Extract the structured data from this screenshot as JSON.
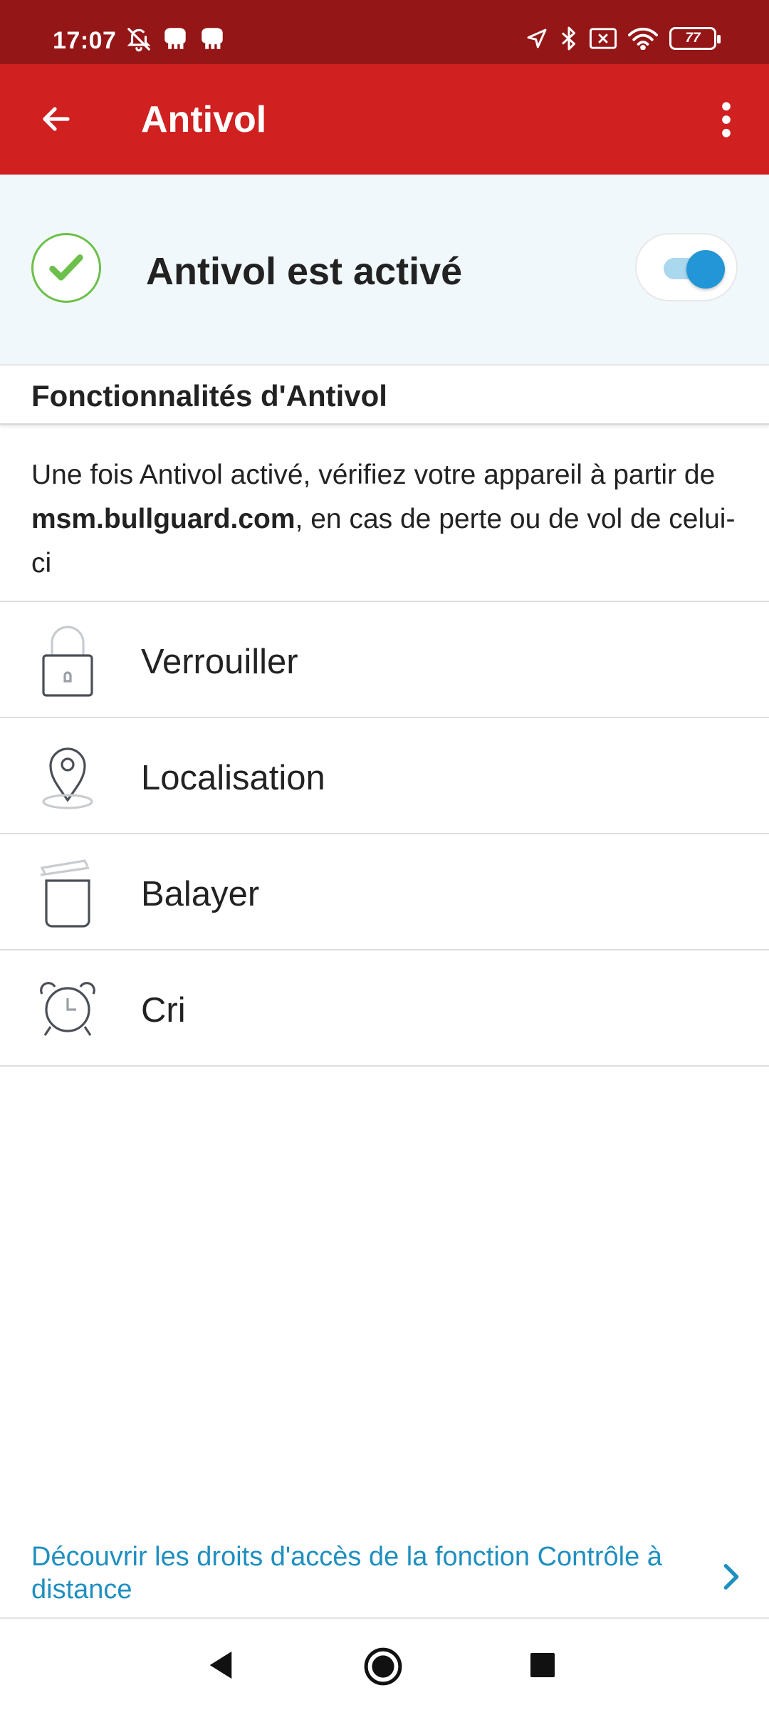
{
  "status_bar": {
    "time": "17:07",
    "battery": "77",
    "left_icons": [
      "muted-alarm-icon",
      "bulldog-icon",
      "bulldog-icon"
    ],
    "right_icons": [
      "location-arrow-icon",
      "bluetooth-icon",
      "no-sim-icon",
      "wifi-icon",
      "battery-icon"
    ]
  },
  "app_bar": {
    "title": "Antivol",
    "colors": {
      "status_bar": "#951617",
      "app_bar": "#d02020"
    }
  },
  "status": {
    "text": "Antivol est activé",
    "toggle_on": true,
    "accent": "#2296d6",
    "check_color": "#6cc04a"
  },
  "section": {
    "title": "Fonctionnalités d'Antivol"
  },
  "description": {
    "before": "Une fois Antivol activé, vérifiez votre appareil à partir de ",
    "link_bold": "msm.bullguard.com",
    "after": ", en cas de perte ou de vol de celui-ci"
  },
  "features": [
    {
      "label": "Verrouiller",
      "icon": "padlock-icon"
    },
    {
      "label": "Localisation",
      "icon": "map-pin-icon"
    },
    {
      "label": "Balayer",
      "icon": "trash-bin-icon"
    },
    {
      "label": "Cri",
      "icon": "alarm-clock-icon"
    }
  ],
  "footer": {
    "link_text": "Découvrir les droits d'accès de la fonction Contrôle à distance",
    "link_color": "#1f8fc0"
  }
}
